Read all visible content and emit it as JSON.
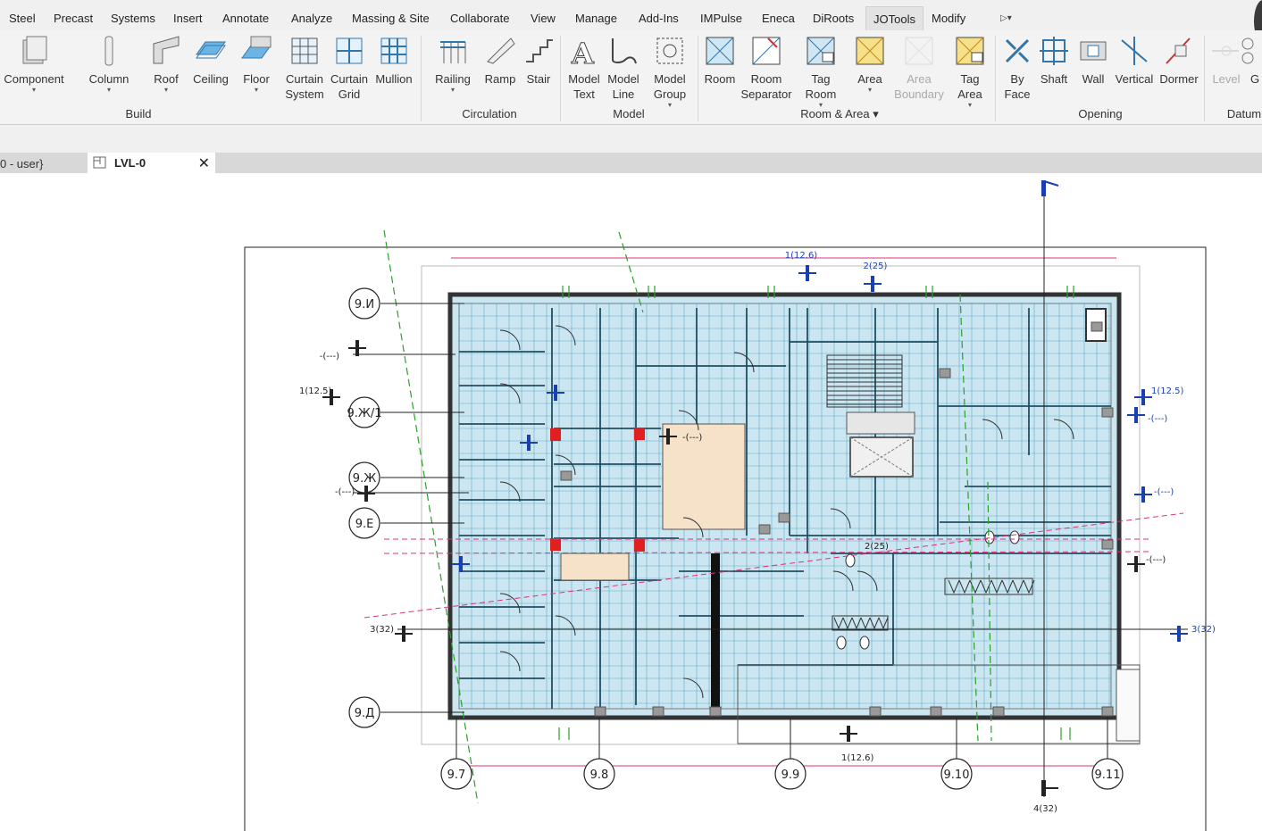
{
  "menu": {
    "tabs": [
      "Steel",
      "Precast",
      "Systems",
      "Insert",
      "Annotate",
      "Analyze",
      "Massing & Site",
      "Collaborate",
      "View",
      "Manage",
      "Add-Ins",
      "IMPulse",
      "Eneca",
      "DiRoots",
      "JOTools",
      "Modify"
    ],
    "active_tab": "JOTools"
  },
  "ribbon": {
    "buttons": [
      {
        "label": "Component",
        "icon": "component-icon",
        "dropdown": true
      },
      {
        "label": "Column",
        "icon": "column-icon",
        "dropdown": true
      },
      {
        "label": "Roof",
        "icon": "roof-icon",
        "dropdown": true
      },
      {
        "label": "Ceiling",
        "icon": "ceiling-icon",
        "dropdown": false
      },
      {
        "label": "Floor",
        "icon": "floor-icon",
        "dropdown": true
      },
      {
        "label": "Curtain\nSystem",
        "icon": "curtain-system-icon",
        "dropdown": false
      },
      {
        "label": "Curtain\nGrid",
        "icon": "curtain-grid-icon",
        "dropdown": false
      },
      {
        "label": "Mullion",
        "icon": "mullion-icon",
        "dropdown": false
      },
      {
        "label": "Railing",
        "icon": "railing-icon",
        "dropdown": true
      },
      {
        "label": "Ramp",
        "icon": "ramp-icon",
        "dropdown": false
      },
      {
        "label": "Stair",
        "icon": "stair-icon",
        "dropdown": false
      },
      {
        "label": "Model\nText",
        "icon": "model-text-icon",
        "dropdown": false
      },
      {
        "label": "Model\nLine",
        "icon": "model-line-icon",
        "dropdown": false
      },
      {
        "label": "Model\nGroup",
        "icon": "model-group-icon",
        "dropdown": true
      },
      {
        "label": "Room",
        "icon": "room-icon",
        "dropdown": false
      },
      {
        "label": "Room\nSeparator",
        "icon": "room-separator-icon",
        "dropdown": false
      },
      {
        "label": "Tag\nRoom",
        "icon": "tag-room-icon",
        "dropdown": true
      },
      {
        "label": "Area",
        "icon": "area-icon",
        "dropdown": true
      },
      {
        "label": "Area\nBoundary",
        "icon": "area-boundary-icon",
        "dropdown": false,
        "disabled": true
      },
      {
        "label": "Tag\nArea",
        "icon": "tag-area-icon",
        "dropdown": true
      },
      {
        "label": "By\nFace",
        "icon": "by-face-icon",
        "dropdown": false
      },
      {
        "label": "Shaft",
        "icon": "shaft-icon",
        "dropdown": false
      },
      {
        "label": "Wall",
        "icon": "wall-opening-icon",
        "dropdown": false
      },
      {
        "label": "Vertical",
        "icon": "vertical-icon",
        "dropdown": false
      },
      {
        "label": "Dormer",
        "icon": "dormer-icon",
        "dropdown": false
      },
      {
        "label": "Level",
        "icon": "level-icon",
        "dropdown": false,
        "disabled": true
      },
      {
        "label": "G",
        "icon": "grid-icon",
        "dropdown": false
      }
    ],
    "groups": [
      {
        "label": "Build"
      },
      {
        "label": "Circulation"
      },
      {
        "label": "Model"
      },
      {
        "label": "Room & Area ▾"
      },
      {
        "label": "Opening"
      },
      {
        "label": "Datum"
      }
    ]
  },
  "view_tabs": {
    "previous_tab": "0 - user}",
    "active_tab": "LVL-0",
    "close_symbol": "✕"
  },
  "drawing": {
    "grid_bubbles_left": [
      "9.И",
      "9.Ж/1",
      "9.Ж",
      "9.E",
      "9.Д"
    ],
    "grid_bubbles_bottom": [
      "9.7",
      "9.8",
      "9.9",
      "9.10",
      "9.11"
    ],
    "section_labels": [
      "1(12.6)",
      "2(25)",
      "-(---)",
      "1(12.5)",
      "1(12.5)",
      "-(---)",
      "-(---)",
      "-(---)",
      "-(---)",
      "-(---)",
      "3(32)",
      "3(32)",
      "1(12.6)",
      "4(32)",
      "2(25)"
    ],
    "colors": {
      "room_fill": "#cbe6f0",
      "grid_line": "#2a8fb5",
      "wall": "#333333",
      "accent_orange": "#f6e1c9",
      "red_column": "#e02020",
      "dashed_magenta": "#e0307a",
      "dashed_green": "#2aa02a",
      "section_blue": "#1a3fb0"
    }
  }
}
